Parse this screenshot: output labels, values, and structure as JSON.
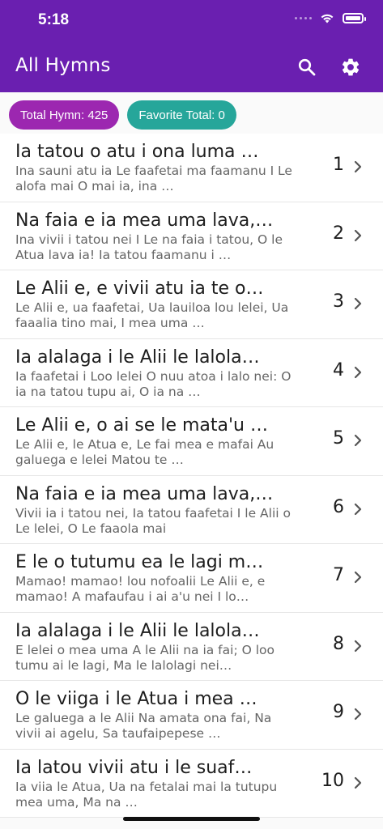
{
  "status_bar": {
    "time": "5:18"
  },
  "app_bar": {
    "title": "All Hymns",
    "search_icon": "search-icon",
    "settings_icon": "gear-icon"
  },
  "chips": {
    "total": "Total Hymn: 425",
    "favorite": "Favorite Total: 0"
  },
  "colors": {
    "app_bar": "#6a1fb0",
    "chip_total": "#9c27b0",
    "chip_favorite": "#26a69a"
  },
  "hymns": [
    {
      "title": "Ia tatou o atu i ona luma …",
      "preview": "Ina sauni atu ia Le faafetai ma faamanu I Le alofa mai O mai ia, ina …",
      "number": "1"
    },
    {
      "title": "Na faia e ia mea uma lava,…",
      "preview": "Ina vivii i tatou nei I Le na faia i tatou, O le Atua lava ia! Ia tatou faamanu i …",
      "number": "2"
    },
    {
      "title": "Le Alii e, e vivii atu ia te o…",
      "preview": "Le Alii e, ua faafetai, Ua lauiloa lou lelei, Ua faaalia tino mai, I mea uma …",
      "number": "3"
    },
    {
      "title": "Ia alalaga i le Alii le lalola…",
      "preview": "Ia faafetai i Loo lelei O nuu atoa i lalo nei: O ia na tatou tupu ai, O ia na …",
      "number": "4"
    },
    {
      "title": "Le Alii e, o ai se le mata'u …",
      "preview": "Le Alii e, le Atua e, Le fai mea e mafai Au galuega e lelei Matou te …",
      "number": "5"
    },
    {
      "title": "Na faia e ia mea uma lava,…",
      "preview": "Vivii ia i tatou nei, Ia tatou faafetai I le Alii o Le lelei, O Le faaola mai",
      "number": "6"
    },
    {
      "title": "E le o tutumu ea le lagi m…",
      "preview": "Mamao! mamao! lou nofoalii Le Alii e, e mamao! A mafaufau i ai a'u nei I lo…",
      "number": "7"
    },
    {
      "title": "Ia alalaga i le Alii le lalola…",
      "preview": "E lelei o mea uma A le Alii na ia fai; O loo tumu ai le lagi, Ma le lalolagi nei…",
      "number": "8"
    },
    {
      "title": "O le viiga i le Atua i mea …",
      "preview": "Le galuega a le Alii Na amata ona fai, Na vivii ai agelu, Sa taufaipepese …",
      "number": "9"
    },
    {
      "title": "Ia latou vivii atu i le suaf…",
      "preview": "Ia viia le Atua, Ua na fetalai mai la tutupu mea uma, Ma na …",
      "number": "10"
    }
  ]
}
